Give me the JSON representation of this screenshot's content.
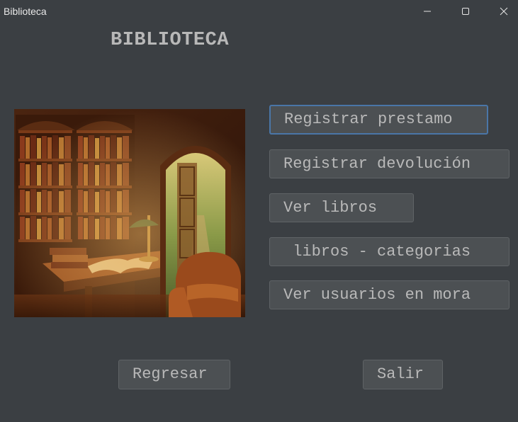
{
  "window": {
    "title": "Biblioteca"
  },
  "header": {
    "title": "BIBLIOTECA"
  },
  "menu": {
    "registrar_prestamo": "Registrar prestamo",
    "registrar_devolucion": "Registrar devolución",
    "ver_libros": "Ver libros",
    "libros_categorias": " libros - categorias",
    "ver_usuarios_mora": "Ver usuarios en mora"
  },
  "footer": {
    "regresar": "Regresar",
    "salir": "Salir"
  },
  "colors": {
    "background": "#3b3f43",
    "button_bg": "#4c5053",
    "button_text": "#b9b9b9",
    "focus_border": "#4a76a8"
  },
  "icons": {
    "minimize": "minimize-icon",
    "maximize": "maximize-icon",
    "close": "close-icon"
  }
}
